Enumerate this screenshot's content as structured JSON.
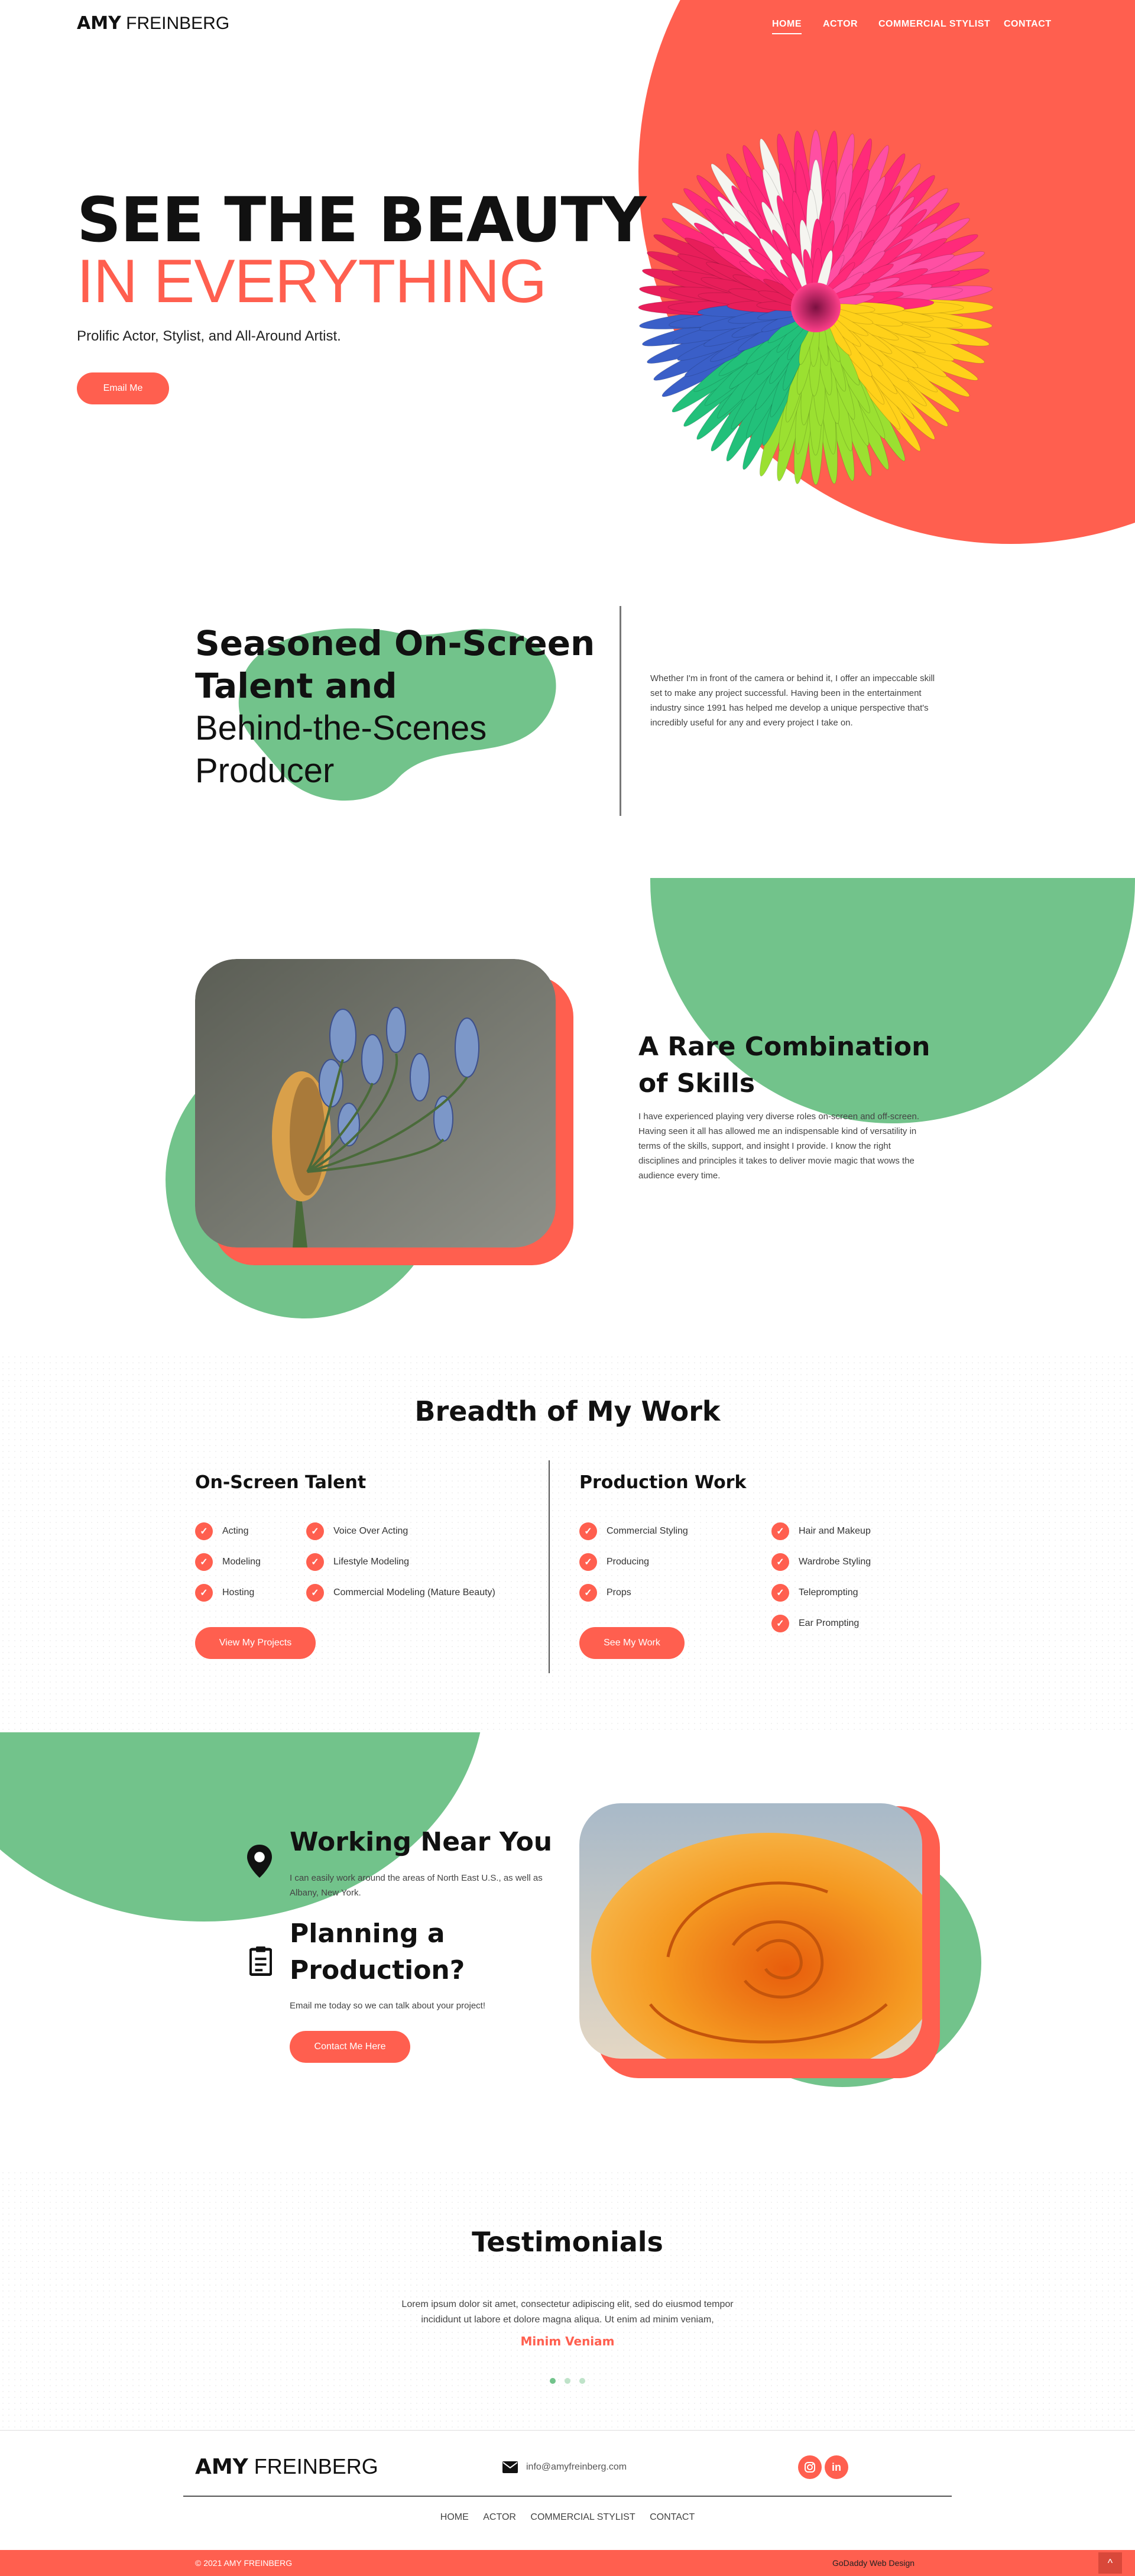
{
  "colors": {
    "accent": "#ff5f4f",
    "green": "#72c38b",
    "dark": "#111111"
  },
  "header": {
    "brand_bold": "AMY",
    "brand_light": "FREINBERG",
    "nav": [
      "HOME",
      "ACTOR",
      "COMMERCIAL STYLIST",
      "CONTACT"
    ]
  },
  "hero": {
    "title_line1": "SEE THE BEAUTY",
    "title_line2": "IN EVERYTHING",
    "subtitle": "Prolific Actor, Stylist, and All-Around Artist.",
    "button": "Email Me"
  },
  "intro": {
    "heading_bold_1": "Seasoned On-Screen",
    "heading_bold_2": "Talent and",
    "heading_light_1": "Behind-the-Scenes",
    "heading_light_2": "Producer",
    "text": "Whether I'm in front of the camera or behind it, I offer an impeccable skill set to make any project successful. Having been in the entertainment industry since 1991 has helped me develop a unique perspective that's incredibly useful for any and every project I take on."
  },
  "skills": {
    "heading_1": "A Rare Combination",
    "heading_2": "of Skills",
    "text": "I have experienced playing very diverse roles on-screen and off-screen. Having seen it all has allowed me an indispensable kind of versatility in terms of the skills, support, and insight I provide. I know the right disciplines and principles it takes to deliver movie magic that wows the audience every time."
  },
  "work": {
    "title": "Breadth of My Work",
    "onscreen": {
      "title": "On-Screen Talent",
      "col1": [
        "Acting",
        "Modeling",
        "Hosting"
      ],
      "col2": [
        "Voice Over Acting",
        "Lifestyle Modeling",
        "Commercial Modeling (Mature Beauty)"
      ],
      "button": "View My Projects"
    },
    "production": {
      "title": "Production Work",
      "col1": [
        "Commercial Styling",
        "Producing",
        "Props"
      ],
      "col2": [
        "Hair and Makeup",
        "Wardrobe Styling",
        "Teleprompting",
        "Ear Prompting"
      ],
      "button": "See My Work"
    }
  },
  "near": {
    "heading": "Working Near You",
    "text": "I can easily work around the areas of North East U.S., as well as Albany, New York.",
    "plan_heading_1": "Planning a",
    "plan_heading_2": "Production?",
    "plan_text": "Email me today so we can talk about your project!",
    "button": "Contact Me Here"
  },
  "testimonials": {
    "title": "Testimonials",
    "quote_1": "Lorem ipsum dolor sit amet, consectetur adipiscing elit, sed do eiusmod tempor",
    "quote_2": "incididunt ut labore et dolore magna aliqua. Ut enim ad minim veniam,",
    "author": "Minim Veniam"
  },
  "footer": {
    "brand_bold": "AMY",
    "brand_light": "FREINBERG",
    "email": "info@amyfreinberg.com",
    "social": [
      "instagram-icon",
      "linkedin-icon"
    ],
    "links": [
      "HOME",
      "ACTOR",
      "COMMERCIAL STYLIST",
      "CONTACT"
    ],
    "copyright": "© 2021 AMY FREINBERG",
    "credit": "GoDaddy Web Design",
    "back_to_top": "^"
  }
}
